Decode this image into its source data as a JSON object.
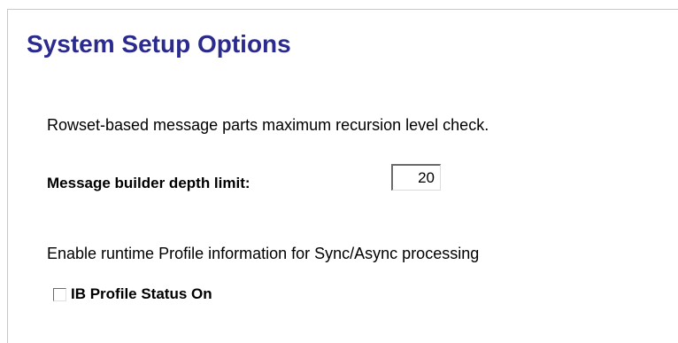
{
  "page": {
    "title": "System Setup Options"
  },
  "recursion": {
    "description": "Rowset-based message parts maximum recursion level check.",
    "depth_label": "Message builder depth limit:",
    "depth_value": "20"
  },
  "profile": {
    "description": "Enable runtime Profile information for Sync/Async processing",
    "status_label": "IB Profile Status On",
    "status_checked": false
  },
  "colors": {
    "title": "#2b2b8f",
    "text": "#000000",
    "background": "#ffffff",
    "frame_border": "#c8c8c8"
  }
}
